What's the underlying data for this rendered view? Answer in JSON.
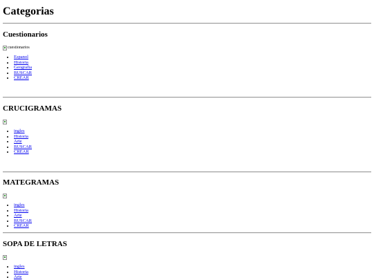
{
  "page": {
    "title": "Categorias"
  },
  "sections": [
    {
      "title": "Cuestionarios",
      "image_alt": "cuestionarios",
      "links": [
        "Espanol",
        "Historia",
        "Geografia",
        "BUSCAR",
        "CREAR"
      ]
    },
    {
      "title": "CRUCIGRAMAS",
      "image_alt": "",
      "links": [
        "ingles",
        "Historia",
        "Arte",
        "BUSCAR",
        "CREAR"
      ]
    },
    {
      "title": "MATEGRAMAS",
      "image_alt": "",
      "links": [
        "ingles",
        "Historia",
        "Arte",
        "BUSCAR",
        "CREAR"
      ]
    },
    {
      "title": "SOPA DE LETRAS",
      "image_alt": "",
      "links": [
        "ingles",
        "Historia",
        "Arte"
      ]
    }
  ]
}
